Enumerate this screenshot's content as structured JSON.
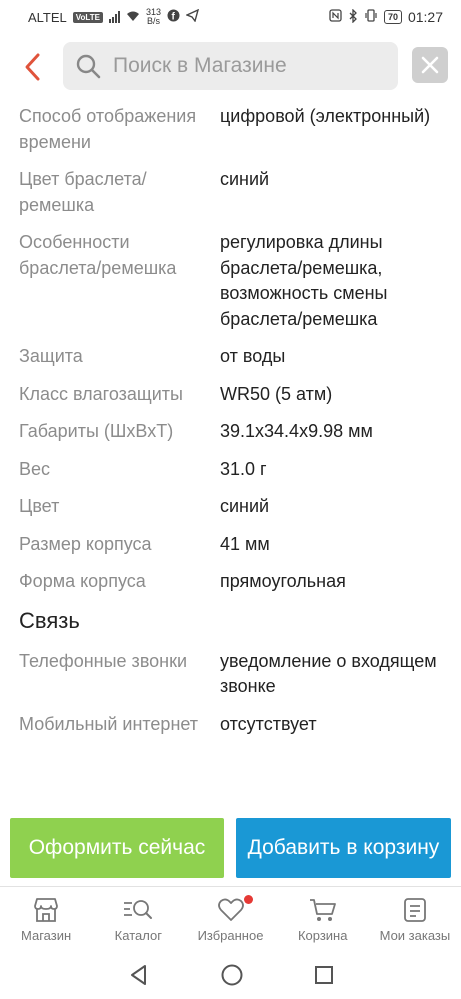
{
  "status_bar": {
    "carrier": "ALTEL",
    "volte": "VoLTE",
    "speed_value": "313",
    "speed_unit": "B/s",
    "battery": "70",
    "time": "01:27"
  },
  "search": {
    "placeholder": "Поиск в Магазине"
  },
  "specs_top": [
    {
      "key": "Способ отображения времени",
      "value": "цифровой (электронный)"
    },
    {
      "key": "Цвет браслета/ремешка",
      "value": "синий"
    },
    {
      "key": "Особенности браслета/ремешка",
      "value": "регулировка длины браслета/ремешка, возможность смены браслета/ремешка"
    },
    {
      "key": "Защита",
      "value": "от воды"
    },
    {
      "key": "Класс влагозащиты",
      "value": "WR50 (5 атм)"
    },
    {
      "key": "Габариты (ШхВхТ)",
      "value": "39.1x34.4x9.98 мм"
    },
    {
      "key": "Вес",
      "value": "31.0 г"
    },
    {
      "key": "Цвет",
      "value": "синий"
    },
    {
      "key": "Размер корпуса",
      "value": "41 мм"
    },
    {
      "key": "Форма корпуса",
      "value": "прямоугольная"
    }
  ],
  "section_connection": {
    "title": "Связь",
    "specs": [
      {
        "key": "Телефонные звонки",
        "value": "уведомление о входящем звонке"
      },
      {
        "key": "Мобильный интернет",
        "value": "отсутствует"
      }
    ]
  },
  "actions": {
    "buy_now": "Оформить сейчас",
    "add_to_cart": "Добавить в корзину"
  },
  "tabs": [
    {
      "label": "Магазин",
      "icon": "store-icon"
    },
    {
      "label": "Каталог",
      "icon": "catalog-search-icon"
    },
    {
      "label": "Избранное",
      "icon": "heart-icon"
    },
    {
      "label": "Корзина",
      "icon": "cart-icon"
    },
    {
      "label": "Мои заказы",
      "icon": "orders-icon"
    }
  ],
  "colors": {
    "accent_red": "#e53935",
    "buy_green": "#8fd14f",
    "cart_blue": "#1a98d5"
  }
}
